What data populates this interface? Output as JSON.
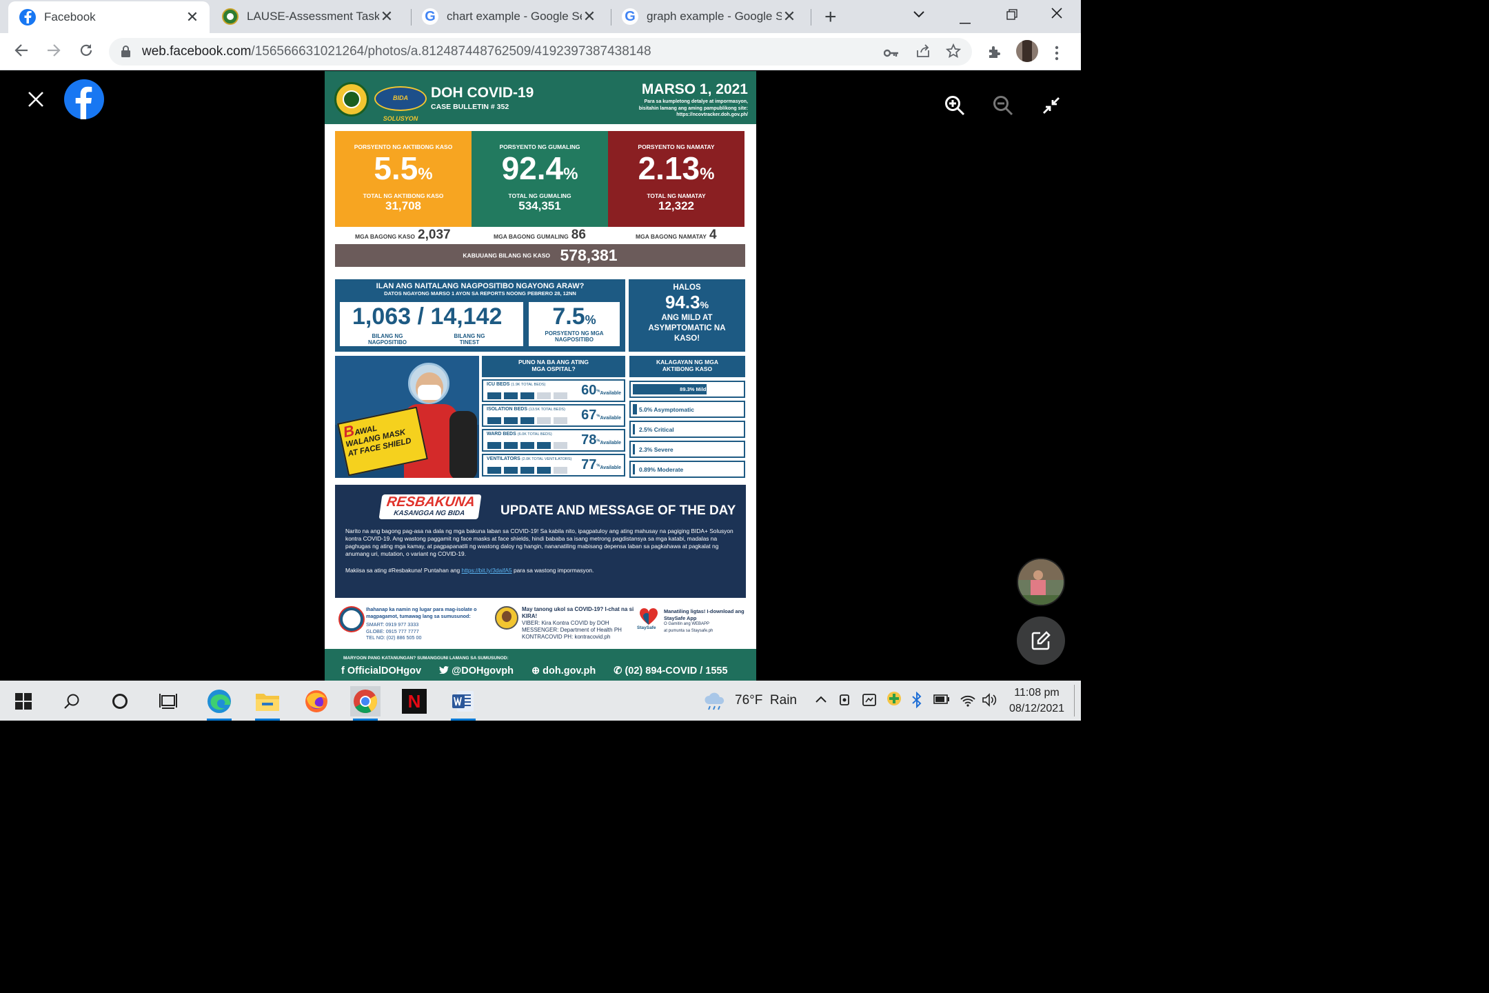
{
  "browser": {
    "tabs": [
      {
        "title": "Facebook",
        "active": true,
        "icon": "facebook-icon"
      },
      {
        "title": "LAUSE-Assessment Task 5",
        "active": false,
        "icon": "seal-icon"
      },
      {
        "title": "chart example - Google Se",
        "active": false,
        "icon": "google-icon"
      },
      {
        "title": "graph example - Google S",
        "active": false,
        "icon": "google-icon"
      }
    ],
    "url_host": "web.facebook.com",
    "url_path": "/156566631021264/photos/a.812487448762509/4192397387438148"
  },
  "poster": {
    "title": "DOH COVID-19",
    "bulletin": "CASE BULLETIN # 352",
    "date": "MARSO 1, 2021",
    "note1": "Para sa kumpletong detalye at impormasyon,",
    "note2": "bisitahin lamang ang aming pampublikong site:",
    "note3": "https://ncovtracker.doh.gov.ph/",
    "logo_text": "BIDA SOLUSYON",
    "active": {
      "label": "PORSYENTO NG AKTIBONG KASO",
      "pct": "5.5",
      "sub": "TOTAL NG AKTIBONG KASO",
      "total": "31,708"
    },
    "recovered": {
      "label": "PORSYENTO NG GUMALING",
      "pct": "92.4",
      "sub": "TOTAL NG GUMALING",
      "total": "534,351"
    },
    "deaths": {
      "label": "PORSYENTO NG NAMATAY",
      "pct": "2.13",
      "sub": "TOTAL NG NAMATAY",
      "total": "12,322"
    },
    "pct_sign": "%",
    "new_cases_label": "MGA BAGONG KASO",
    "new_cases": "2,037",
    "new_recovered_label": "MGA BAGONG GUMALING",
    "new_recovered": "86",
    "new_deaths_label": "MGA BAGONG NAMATAY",
    "new_deaths": "4",
    "total_label": "KABUUANG BILANG NG KASO",
    "total_cases": "578,381",
    "tests_title": "ILAN ANG NAITALANG NAGPOSITIBO NGAYONG ARAW?",
    "tests_sub": "DATOS NGAYONG MARSO 1 AYON SA REPORTS NOONG PEBRERO 28, 12NN",
    "positive": "1,063",
    "tested": "14,142",
    "positive_label": "BILANG NG NAGPOSITIBO",
    "tested_label": "BILANG NG TINEST",
    "positivity": "7.5",
    "positivity_label": "PORSYENTO NG MGA NAGPOSITIBO",
    "halos": "HALOS",
    "mild_pct": "94.3",
    "mild_label": "ANG MILD AT ASYMPTOMATIC NA KASO!",
    "mask_line1": "AWAL",
    "mask_line1_big": "B",
    "mask_line2": "WALANG MASK",
    "mask_line3": "AT FACE SHIELD",
    "hosp_title": "PUNO NA BA ANG ATING MGA OSPITAL?",
    "available": "Available",
    "beds": [
      {
        "name": "ICU BEDS",
        "cap": "(1.9K TOTAL BEDS)",
        "pct": "60",
        "used": 3
      },
      {
        "name": "ISOLATION BEDS",
        "cap": "(13.5K TOTAL BEDS)",
        "pct": "67",
        "used": 3
      },
      {
        "name": "WARD BEDS",
        "cap": "(6.0K TOTAL BEDS)",
        "pct": "78",
        "used": 4
      },
      {
        "name": "VENTILATORS",
        "cap": "(2.0K TOTAL VENTILATORS)",
        "pct": "77",
        "used": 4
      }
    ],
    "cases_title": "KALAGAYAN NG MGA AKTIBONG KASO",
    "case_status": [
      {
        "label": "89.3% Mild",
        "value": 89.3
      },
      {
        "label": "5.0% Asymptomatic",
        "value": 5.0
      },
      {
        "label": "2.5% Critical",
        "value": 2.5
      },
      {
        "label": "2.3% Severe",
        "value": 2.3
      },
      {
        "label": "0.89% Moderate",
        "value": 0.89
      }
    ],
    "resbakuna": "RESBAKUNA",
    "kasangga": "KASANGGA NG BIDA",
    "update_title": "UPDATE AND MESSAGE OF THE DAY",
    "msg_body": "Narito na ang bagong pag-asa na dala ng mga bakuna laban sa COVID-19! Sa kabila nito, ipagpatuloy ang ating mahusay na pagiging BIDA+ Solusyon kontra COVID-19. Ang wastong paggamit ng face masks at face shields, hindi bababa sa isang metrong pagdistansya sa mga katabi, madalas na paghugas ng ating mga kamay, at pagpapanatili ng wastong daloy ng hangin, nananatiling mabisang depensa laban sa pagkahawa at pagkalat ng anumang uri, mutation, o variant ng COVID-19.",
    "msg_cta_a": "Makiisa sa ating #Resbakuna! Puntahan ang ",
    "msg_link": "https://bit.ly/3daifA5",
    "msg_cta_b": " para sa wastong impormasyon.",
    "c1_head": "Ihahanap ka namin ng lugar para mag-isolate o magpagamot, tumawag lang sa sumusunod:",
    "c1_lines": [
      "SMART: 0919 977 3333",
      "GLOBE: 0915 777 7777",
      "TEL NO: (02) 886 505 00"
    ],
    "c2_head": "May tanong ukol sa COVID-19? I-chat na si KIRA!",
    "c2_lines": [
      "VIBER: Kira Kontra COVID by DOH",
      "MESSENGER: Department of Health PH",
      "KONTRACOVID PH: kontracovid.ph"
    ],
    "c3_head": "Manatiling ligtas! I-download ang StaySafe App",
    "c3_lines": [
      "O Gamitin ang WEBAPP",
      "at pumunta sa Staysafe.ph"
    ],
    "staysafe": "StaySafe",
    "foot_note": "MARYOON PANG KATANUNGAN? SUMANGGUNI LAMANG SA SUMUSUNOD:",
    "foot_fb": "OfficialDOHgov",
    "foot_tw": "@DOHgovph",
    "foot_web": "doh.gov.ph",
    "foot_tel": "(02) 894-COVID  /  1555"
  },
  "taskbar": {
    "weather_temp": "76°F",
    "weather_text": "Rain",
    "time": "11:08 pm",
    "date": "08/12/2021"
  }
}
